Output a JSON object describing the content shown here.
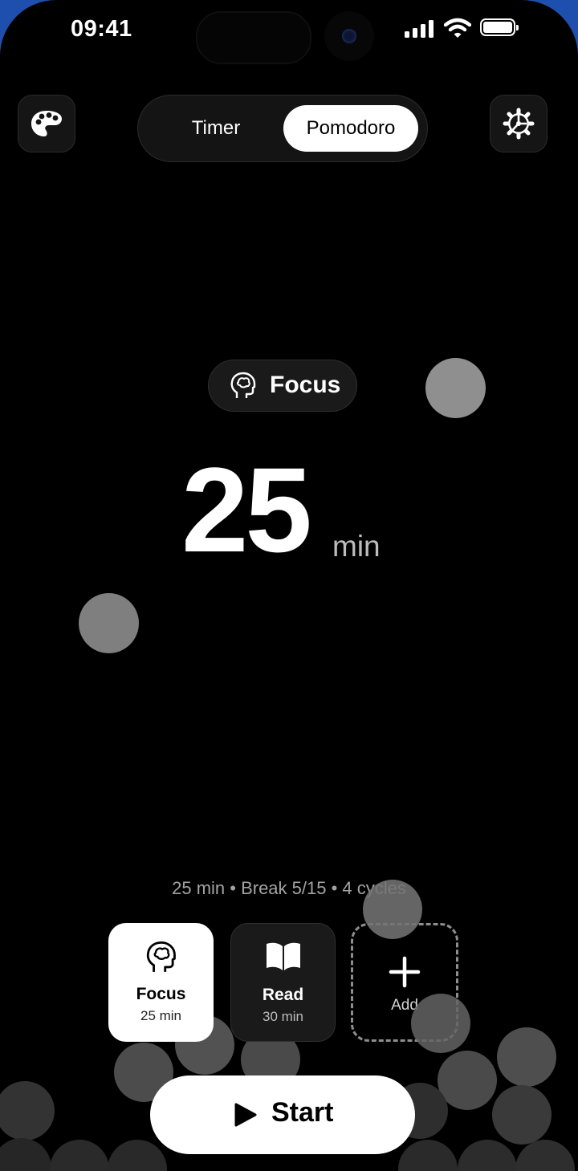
{
  "status": {
    "time": "09:41"
  },
  "toolbar": {
    "palette_icon": "palette-icon",
    "settings_icon": "settings-icon"
  },
  "mode_switch": {
    "options": [
      "Timer",
      "Pomodoro"
    ],
    "selected": "Pomodoro"
  },
  "session": {
    "chip_label": "Focus",
    "chip_icon": "brain-head-icon",
    "minutes": "25",
    "unit": "min"
  },
  "summary": "25 min • Break 5/15 • 4 cycles",
  "presets": [
    {
      "name": "Focus",
      "duration": "25 min",
      "icon": "brain-head-icon",
      "selected": true
    },
    {
      "name": "Read",
      "duration": "30 min",
      "icon": "book-icon",
      "selected": false
    }
  ],
  "add_preset": {
    "label": "Add",
    "icon": "plus-icon"
  },
  "start_button": {
    "label": "Start",
    "icon": "play-icon"
  },
  "colors": {
    "background": "#000000",
    "accent": "#ffffff",
    "muted_text": "#a3a3a3",
    "frame_edge": "#1f4fae"
  }
}
